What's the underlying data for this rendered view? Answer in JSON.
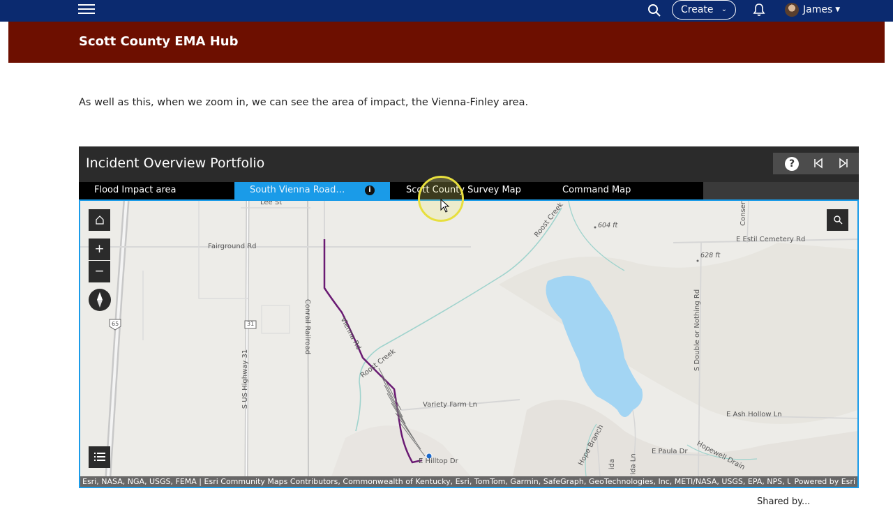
{
  "nav": {
    "create_label": "Create",
    "user_name": "James",
    "icons": [
      "menu-icon",
      "search-icon",
      "chevron-down-icon",
      "bell-icon",
      "avatar",
      "caret-down-icon"
    ]
  },
  "site": {
    "title": "Scott County EMA Hub",
    "header_color": "#6d0f00",
    "nav_color": "#0b2a6f"
  },
  "content": {
    "intro": "As well as this, when we zoom in, we can see the area of impact, the Vienna-Finley area."
  },
  "portfolio": {
    "title": "Incident Overview Portfolio",
    "help_label": "?",
    "tabs": [
      {
        "label": "Flood Impact area",
        "active": false
      },
      {
        "label": "South Vienna Road…",
        "active": true
      },
      {
        "label": "Scott County Survey Map",
        "active": false
      },
      {
        "label": "Command Map",
        "active": false
      }
    ],
    "active_tab_color": "#1a9be8"
  },
  "map": {
    "labels": {
      "lee_st": "Lee St",
      "fairground": "Fairground Rd",
      "roost_creek_top": "Roost Creek",
      "elev_604": "604 ft",
      "estil_cemetery": "E Estil Cemetery Rd",
      "conserv": "Conserv",
      "elev_628": "628 ft",
      "conrail": "Conrail Railroad",
      "vienna_rd": "Vienna Rd",
      "us_highway": "S US Highway 31",
      "route_65": "65",
      "route_31": "31",
      "roost_creek_bottom": "Roost Creek",
      "double_or_nothing": "S Double or Nothing Rd",
      "variety_farm": "Variety Farm Ln",
      "ash_hollow": "E Ash Hollow Ln",
      "hope_branch": "Hope Branch",
      "paula": "E Paula Dr",
      "hopewell": "Hopewell Drain",
      "hilltop": "E Hilltop Dr",
      "ida": "ida Ln",
      "ida2": "ida"
    },
    "zoom_in": "+",
    "zoom_out": "−",
    "attribution": "Esri, NASA, NGA, USGS, FEMA | Esri Community Maps Contributors, Commonwealth of Kentucky, Esri, TomTom, Garmin, SafeGraph, GeoTechnologies, Inc, METI/NASA, USGS, EPA, NPS, US …",
    "powered_by": "Powered by Esri",
    "icons": [
      "home-icon",
      "zoom-in-icon",
      "zoom-out-icon",
      "compass-icon",
      "search-icon",
      "legend-icon"
    ]
  },
  "footer_partial": "Shared by..."
}
